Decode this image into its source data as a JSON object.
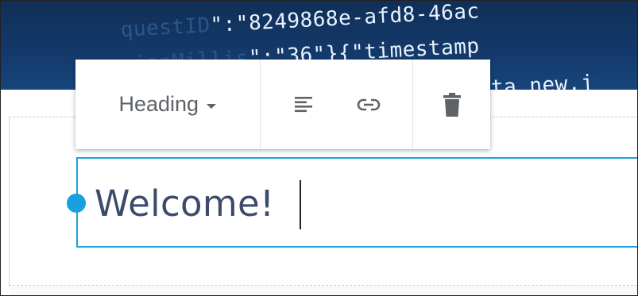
{
  "background_code": {
    "line1_dim": "questID",
    "line1_bright": "\":\"8249868e-afd8-46ac",
    "line2_dim": "sionMillis",
    "line2_bright": "\":\"36\"}{\"timestamp",
    "line3_bright": "ata_new.j"
  },
  "toolbar": {
    "heading_label": "Heading",
    "icons": [
      "align-left-icon",
      "link-icon",
      "trash-icon"
    ]
  },
  "editor": {
    "text": "Welcome!"
  },
  "colors": {
    "accent": "#1aa3d9",
    "banner": "#143a6b",
    "text": "#3d4b6b",
    "icon": "#5f6368"
  }
}
